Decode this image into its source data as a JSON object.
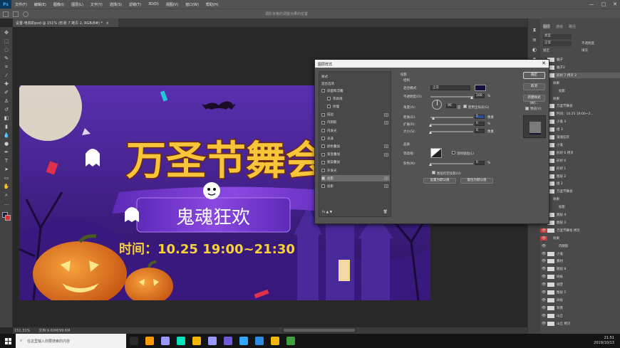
{
  "app": {
    "logo": "Ps",
    "menus": [
      "文件(F)",
      "编辑(E)",
      "图像(I)",
      "图层(L)",
      "文字(Y)",
      "选择(S)",
      "滤镜(T)",
      "3D(D)",
      "视图(V)",
      "窗口(W)",
      "帮助(H)"
    ],
    "window_controls": [
      "—",
      "□",
      "✕"
    ]
  },
  "options_bar": {
    "hint": "调阶单格的调整功果的位置"
  },
  "document": {
    "tab_title": "设置-电商的psd @ 151% (形状 7 拷贝 2, RGB/8#) *",
    "tab_close": "×"
  },
  "status": {
    "zoom": "151.31%",
    "doc_size": "文档:9.60M/99.6M"
  },
  "artwork": {
    "title": "万圣节舞会",
    "subtitle": "鬼魂狂欢",
    "time_text": "时间：10.25 19:00~21:30",
    "colors": {
      "bg_top": "#5a2fb0",
      "bg_bottom": "#2a1260",
      "title": "#f7c43a",
      "title_stroke": "#6a2c12",
      "ribbon": "#7c3ad0",
      "pumpkin": "#e8731c",
      "moon": "#e9e6c8"
    }
  },
  "panels": {
    "tabs": [
      "图层",
      "通道",
      "路径"
    ],
    "filter_label": "类型",
    "blend_mode": "正常",
    "opacity_label": "不透明度",
    "fill_label": "填充",
    "lock_label": "锁定",
    "layers": [
      {
        "name": "蝠子",
        "indent": 0,
        "eye": ""
      },
      {
        "name": "蝠子2",
        "indent": 0,
        "eye": ""
      },
      {
        "name": "形状 7 拷贝 2",
        "indent": 0,
        "eye": "👁",
        "selected": true
      },
      {
        "name": "效果",
        "indent": 1,
        "eye": ""
      },
      {
        "name": "投影",
        "indent": 2,
        "eye": ""
      },
      {
        "name": "效果",
        "indent": 1,
        "eye": ""
      },
      {
        "name": "万圣节舞会",
        "indent": 0,
        "eye": ""
      },
      {
        "name": "时间：10.25 19:00~2...",
        "indent": 0,
        "eye": ""
      },
      {
        "name": "小鬼 3",
        "indent": 0,
        "eye": ""
      },
      {
        "name": "组 3",
        "indent": 0,
        "eye": ""
      },
      {
        "name": "鬼魂狂欢",
        "indent": 0,
        "eye": ""
      },
      {
        "name": "小鬼",
        "indent": 0,
        "eye": ""
      },
      {
        "name": "形状 6 拷贝",
        "indent": 0,
        "eye": ""
      },
      {
        "name": "形状 6",
        "indent": 0,
        "eye": ""
      },
      {
        "name": "形状 1",
        "indent": 0,
        "eye": ""
      },
      {
        "name": "图层 2",
        "indent": 0,
        "eye": ""
      },
      {
        "name": "组 2",
        "indent": 0,
        "eye": ""
      },
      {
        "name": "万圣节舞会",
        "indent": 0,
        "eye": "👁"
      },
      {
        "name": "效果",
        "indent": 1,
        "eye": "👁"
      },
      {
        "name": "投影",
        "indent": 2,
        "eye": "👁"
      },
      {
        "name": "图层 4",
        "indent": 0,
        "eye": "👁"
      },
      {
        "name": "图层 3",
        "indent": 0,
        "eye": "👁"
      },
      {
        "name": "万圣节舞会 拷贝",
        "indent": 0,
        "eye": "👁",
        "red": true
      },
      {
        "name": "效果",
        "indent": 1,
        "eye": "👁",
        "red": true
      },
      {
        "name": "内阴影",
        "indent": 2,
        "eye": "👁"
      },
      {
        "name": "小鬼",
        "indent": 0,
        "eye": "👁"
      },
      {
        "name": "素材",
        "indent": 0,
        "eye": "👁"
      },
      {
        "name": "图层 8",
        "indent": 0,
        "eye": "👁"
      },
      {
        "name": "树枝",
        "indent": 0,
        "eye": "👁"
      },
      {
        "name": "城堡",
        "indent": 0,
        "eye": "👁"
      },
      {
        "name": "图层 5",
        "indent": 0,
        "eye": "👁"
      },
      {
        "name": "树枝",
        "indent": 0,
        "eye": "👁"
      },
      {
        "name": "背景",
        "indent": 0,
        "eye": "👁"
      },
      {
        "name": "山丘",
        "indent": 0,
        "eye": "👁"
      },
      {
        "name": "山丘 拷贝",
        "indent": 0,
        "eye": "👁"
      }
    ]
  },
  "dialog": {
    "title": "图层样式",
    "close": "✕",
    "styles_header": "样式",
    "blend_options": "混合选项",
    "styles": [
      {
        "label": "斜面和浮雕",
        "checked": false,
        "plus": false
      },
      {
        "label": "等高线",
        "checked": false,
        "plus": false,
        "indent": true
      },
      {
        "label": "纹理",
        "checked": false,
        "plus": false,
        "indent": true
      },
      {
        "label": "描边",
        "checked": false,
        "plus": true
      },
      {
        "label": "内阴影",
        "checked": false,
        "plus": true
      },
      {
        "label": "内发光",
        "checked": false,
        "plus": false
      },
      {
        "label": "光泽",
        "checked": false,
        "plus": false
      },
      {
        "label": "颜色叠加",
        "checked": false,
        "plus": true
      },
      {
        "label": "渐变叠加",
        "checked": false,
        "plus": true
      },
      {
        "label": "图案叠加",
        "checked": false,
        "plus": false
      },
      {
        "label": "外发光",
        "checked": false,
        "plus": false
      },
      {
        "label": "投影",
        "checked": true,
        "plus": true,
        "selected": true
      },
      {
        "label": "投影",
        "checked": false,
        "plus": true
      }
    ],
    "fx_icons": "fx  ▲  ▼",
    "section_title": "投影",
    "structure_label": "结构",
    "blend_mode_label": "混合模式:",
    "blend_mode_value": "正常",
    "opacity_label": "不透明度(O):",
    "opacity_value": "100",
    "angle_label": "角度(A):",
    "angle_value": "90",
    "global_light_label": "使用全局光(G)",
    "distance_label": "距离(D):",
    "distance_value": "5",
    "spread_label": "扩展(R):",
    "spread_value": "0",
    "size_label": "大小(S):",
    "size_value": "0",
    "unit_px": "像素",
    "unit_pct": "%",
    "unit_deg": "度",
    "quality_label": "品质",
    "contour_label": "等高线:",
    "anti_alias_label": "消除锯齿(L)",
    "noise_label": "杂色(N):",
    "noise_value": "0",
    "knockout_label": "图层挖空投影(U)",
    "make_default": "设置为默认值",
    "reset_default": "复位为默认值",
    "buttons": [
      "确定",
      "取消",
      "新建样式(W)..."
    ],
    "preview_label": "预览(V)",
    "shadow_color": "#14123c"
  },
  "taskbar": {
    "search_placeholder": "在这里输入你要搜索的内容",
    "time": "21:51",
    "date": "2019/10/13",
    "apps": [
      {
        "name": "task-view",
        "color": "#2a2a2a"
      },
      {
        "name": "illustrator",
        "color": "#ff9a00"
      },
      {
        "name": "after-effects",
        "color": "#9999ff"
      },
      {
        "name": "audition",
        "color": "#00e4bb"
      },
      {
        "name": "chrome",
        "color": "#f2b705"
      },
      {
        "name": "premiere",
        "color": "#9999ff"
      },
      {
        "name": "media-encoder",
        "color": "#6b5bd6"
      },
      {
        "name": "photoshop",
        "color": "#31a8ff"
      },
      {
        "name": "app-s",
        "color": "#2c8ce0"
      },
      {
        "name": "chrome-2",
        "color": "#f2b705"
      },
      {
        "name": "app-g",
        "color": "#3f9f3f"
      }
    ]
  }
}
